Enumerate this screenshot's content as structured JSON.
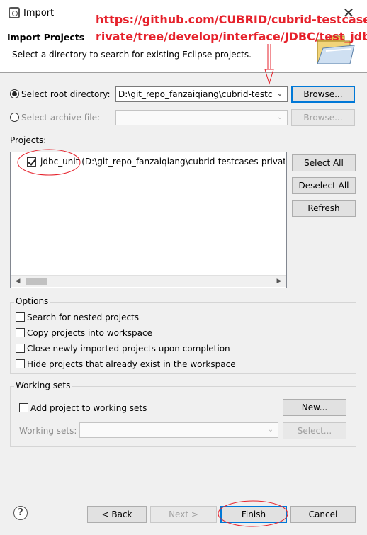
{
  "window": {
    "title": "Import",
    "close_glyph": "✕"
  },
  "header": {
    "title": "Import Projects",
    "description": "Select a directory to search for existing Eclipse projects."
  },
  "annotation": {
    "line1": "https://github.com/CUBRID/cubrid-testcases-",
    "line2": "rivate/tree/develop/interface/JDBC/test_jdbc",
    "color": "#e6212b"
  },
  "source": {
    "root_label": "Select root directory:",
    "root_value": "D:\\git_repo_fanzaiqiang\\cubrid-testcases",
    "root_selected": true,
    "browse_label": "Browse...",
    "archive_label": "Select archive file:",
    "archive_value": "",
    "archive_browse_label": "Browse..."
  },
  "projects": {
    "label": "Projects:",
    "items": [
      {
        "name": "jdbc_unit",
        "path": "(D:\\git_repo_fanzaiqiang\\cubrid-testcases-private\\",
        "checked": true
      }
    ],
    "select_all_label": "Select All",
    "deselect_all_label": "Deselect All",
    "refresh_label": "Refresh"
  },
  "options": {
    "title": "Options",
    "items": [
      {
        "label": "Search for nested projects",
        "checked": false
      },
      {
        "label": "Copy projects into workspace",
        "checked": false
      },
      {
        "label": "Close newly imported projects upon completion",
        "checked": false
      },
      {
        "label": "Hide projects that already exist in the workspace",
        "checked": false
      }
    ]
  },
  "working_sets": {
    "title": "Working sets",
    "add_label": "Add project to working sets",
    "add_checked": false,
    "new_label": "New...",
    "sets_label": "Working sets:",
    "sets_value": "",
    "select_label": "Select..."
  },
  "footer": {
    "help_glyph": "?",
    "back_label": "< Back",
    "next_label": "Next >",
    "finish_label": "Finish",
    "cancel_label": "Cancel"
  },
  "icons": {
    "app": "eclipse-import-icon",
    "folder": "folder-icon",
    "help": "help-icon"
  }
}
